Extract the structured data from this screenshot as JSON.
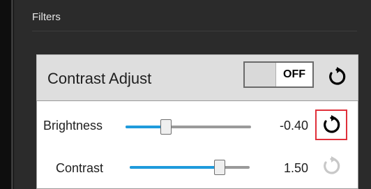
{
  "section": {
    "title": "Filters"
  },
  "filter": {
    "title": "Contrast Adjust",
    "toggle_state": "OFF",
    "parameters": [
      {
        "label": "Brightness",
        "value": "-0.40",
        "slider_fraction": 0.32,
        "reset_enabled": true,
        "reset_highlighted": true
      },
      {
        "label": "Contrast",
        "value": "1.50",
        "slider_fraction": 0.75,
        "reset_enabled": false,
        "reset_highlighted": false
      }
    ]
  },
  "colors": {
    "accent": "#1f9bdc",
    "highlight": "#e0303a",
    "disabled_icon": "#c8c8c8"
  },
  "icons": {
    "reset": "reset-icon",
    "highlight_box": "red-focus-outline"
  }
}
